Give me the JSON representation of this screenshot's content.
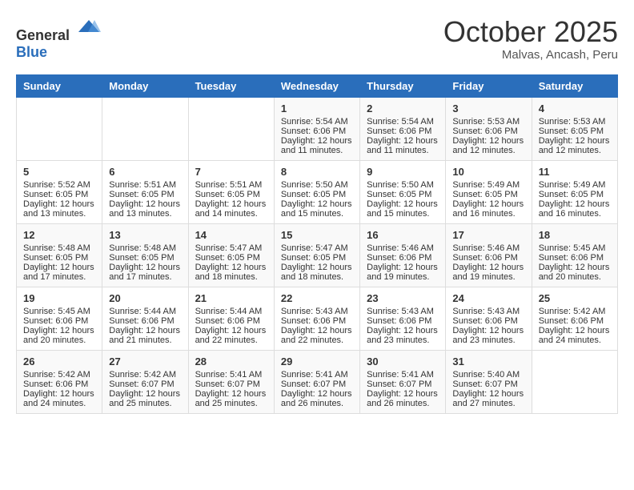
{
  "header": {
    "logo": {
      "general": "General",
      "blue": "Blue"
    },
    "title": "October 2025",
    "location": "Malvas, Ancash, Peru"
  },
  "weekdays": [
    "Sunday",
    "Monday",
    "Tuesday",
    "Wednesday",
    "Thursday",
    "Friday",
    "Saturday"
  ],
  "weeks": [
    [
      {
        "day": "",
        "data": ""
      },
      {
        "day": "",
        "data": ""
      },
      {
        "day": "",
        "data": ""
      },
      {
        "day": "1",
        "sunrise": "5:54 AM",
        "sunset": "6:06 PM",
        "daylight": "12 hours and 11 minutes."
      },
      {
        "day": "2",
        "sunrise": "5:54 AM",
        "sunset": "6:06 PM",
        "daylight": "12 hours and 11 minutes."
      },
      {
        "day": "3",
        "sunrise": "5:53 AM",
        "sunset": "6:06 PM",
        "daylight": "12 hours and 12 minutes."
      },
      {
        "day": "4",
        "sunrise": "5:53 AM",
        "sunset": "6:05 PM",
        "daylight": "12 hours and 12 minutes."
      }
    ],
    [
      {
        "day": "5",
        "sunrise": "5:52 AM",
        "sunset": "6:05 PM",
        "daylight": "12 hours and 13 minutes."
      },
      {
        "day": "6",
        "sunrise": "5:51 AM",
        "sunset": "6:05 PM",
        "daylight": "12 hours and 13 minutes."
      },
      {
        "day": "7",
        "sunrise": "5:51 AM",
        "sunset": "6:05 PM",
        "daylight": "12 hours and 14 minutes."
      },
      {
        "day": "8",
        "sunrise": "5:50 AM",
        "sunset": "6:05 PM",
        "daylight": "12 hours and 15 minutes."
      },
      {
        "day": "9",
        "sunrise": "5:50 AM",
        "sunset": "6:05 PM",
        "daylight": "12 hours and 15 minutes."
      },
      {
        "day": "10",
        "sunrise": "5:49 AM",
        "sunset": "6:05 PM",
        "daylight": "12 hours and 16 minutes."
      },
      {
        "day": "11",
        "sunrise": "5:49 AM",
        "sunset": "6:05 PM",
        "daylight": "12 hours and 16 minutes."
      }
    ],
    [
      {
        "day": "12",
        "sunrise": "5:48 AM",
        "sunset": "6:05 PM",
        "daylight": "12 hours and 17 minutes."
      },
      {
        "day": "13",
        "sunrise": "5:48 AM",
        "sunset": "6:05 PM",
        "daylight": "12 hours and 17 minutes."
      },
      {
        "day": "14",
        "sunrise": "5:47 AM",
        "sunset": "6:05 PM",
        "daylight": "12 hours and 18 minutes."
      },
      {
        "day": "15",
        "sunrise": "5:47 AM",
        "sunset": "6:05 PM",
        "daylight": "12 hours and 18 minutes."
      },
      {
        "day": "16",
        "sunrise": "5:46 AM",
        "sunset": "6:06 PM",
        "daylight": "12 hours and 19 minutes."
      },
      {
        "day": "17",
        "sunrise": "5:46 AM",
        "sunset": "6:06 PM",
        "daylight": "12 hours and 19 minutes."
      },
      {
        "day": "18",
        "sunrise": "5:45 AM",
        "sunset": "6:06 PM",
        "daylight": "12 hours and 20 minutes."
      }
    ],
    [
      {
        "day": "19",
        "sunrise": "5:45 AM",
        "sunset": "6:06 PM",
        "daylight": "12 hours and 20 minutes."
      },
      {
        "day": "20",
        "sunrise": "5:44 AM",
        "sunset": "6:06 PM",
        "daylight": "12 hours and 21 minutes."
      },
      {
        "day": "21",
        "sunrise": "5:44 AM",
        "sunset": "6:06 PM",
        "daylight": "12 hours and 22 minutes."
      },
      {
        "day": "22",
        "sunrise": "5:43 AM",
        "sunset": "6:06 PM",
        "daylight": "12 hours and 22 minutes."
      },
      {
        "day": "23",
        "sunrise": "5:43 AM",
        "sunset": "6:06 PM",
        "daylight": "12 hours and 23 minutes."
      },
      {
        "day": "24",
        "sunrise": "5:43 AM",
        "sunset": "6:06 PM",
        "daylight": "12 hours and 23 minutes."
      },
      {
        "day": "25",
        "sunrise": "5:42 AM",
        "sunset": "6:06 PM",
        "daylight": "12 hours and 24 minutes."
      }
    ],
    [
      {
        "day": "26",
        "sunrise": "5:42 AM",
        "sunset": "6:06 PM",
        "daylight": "12 hours and 24 minutes."
      },
      {
        "day": "27",
        "sunrise": "5:42 AM",
        "sunset": "6:07 PM",
        "daylight": "12 hours and 25 minutes."
      },
      {
        "day": "28",
        "sunrise": "5:41 AM",
        "sunset": "6:07 PM",
        "daylight": "12 hours and 25 minutes."
      },
      {
        "day": "29",
        "sunrise": "5:41 AM",
        "sunset": "6:07 PM",
        "daylight": "12 hours and 26 minutes."
      },
      {
        "day": "30",
        "sunrise": "5:41 AM",
        "sunset": "6:07 PM",
        "daylight": "12 hours and 26 minutes."
      },
      {
        "day": "31",
        "sunrise": "5:40 AM",
        "sunset": "6:07 PM",
        "daylight": "12 hours and 27 minutes."
      },
      {
        "day": "",
        "data": ""
      }
    ]
  ]
}
